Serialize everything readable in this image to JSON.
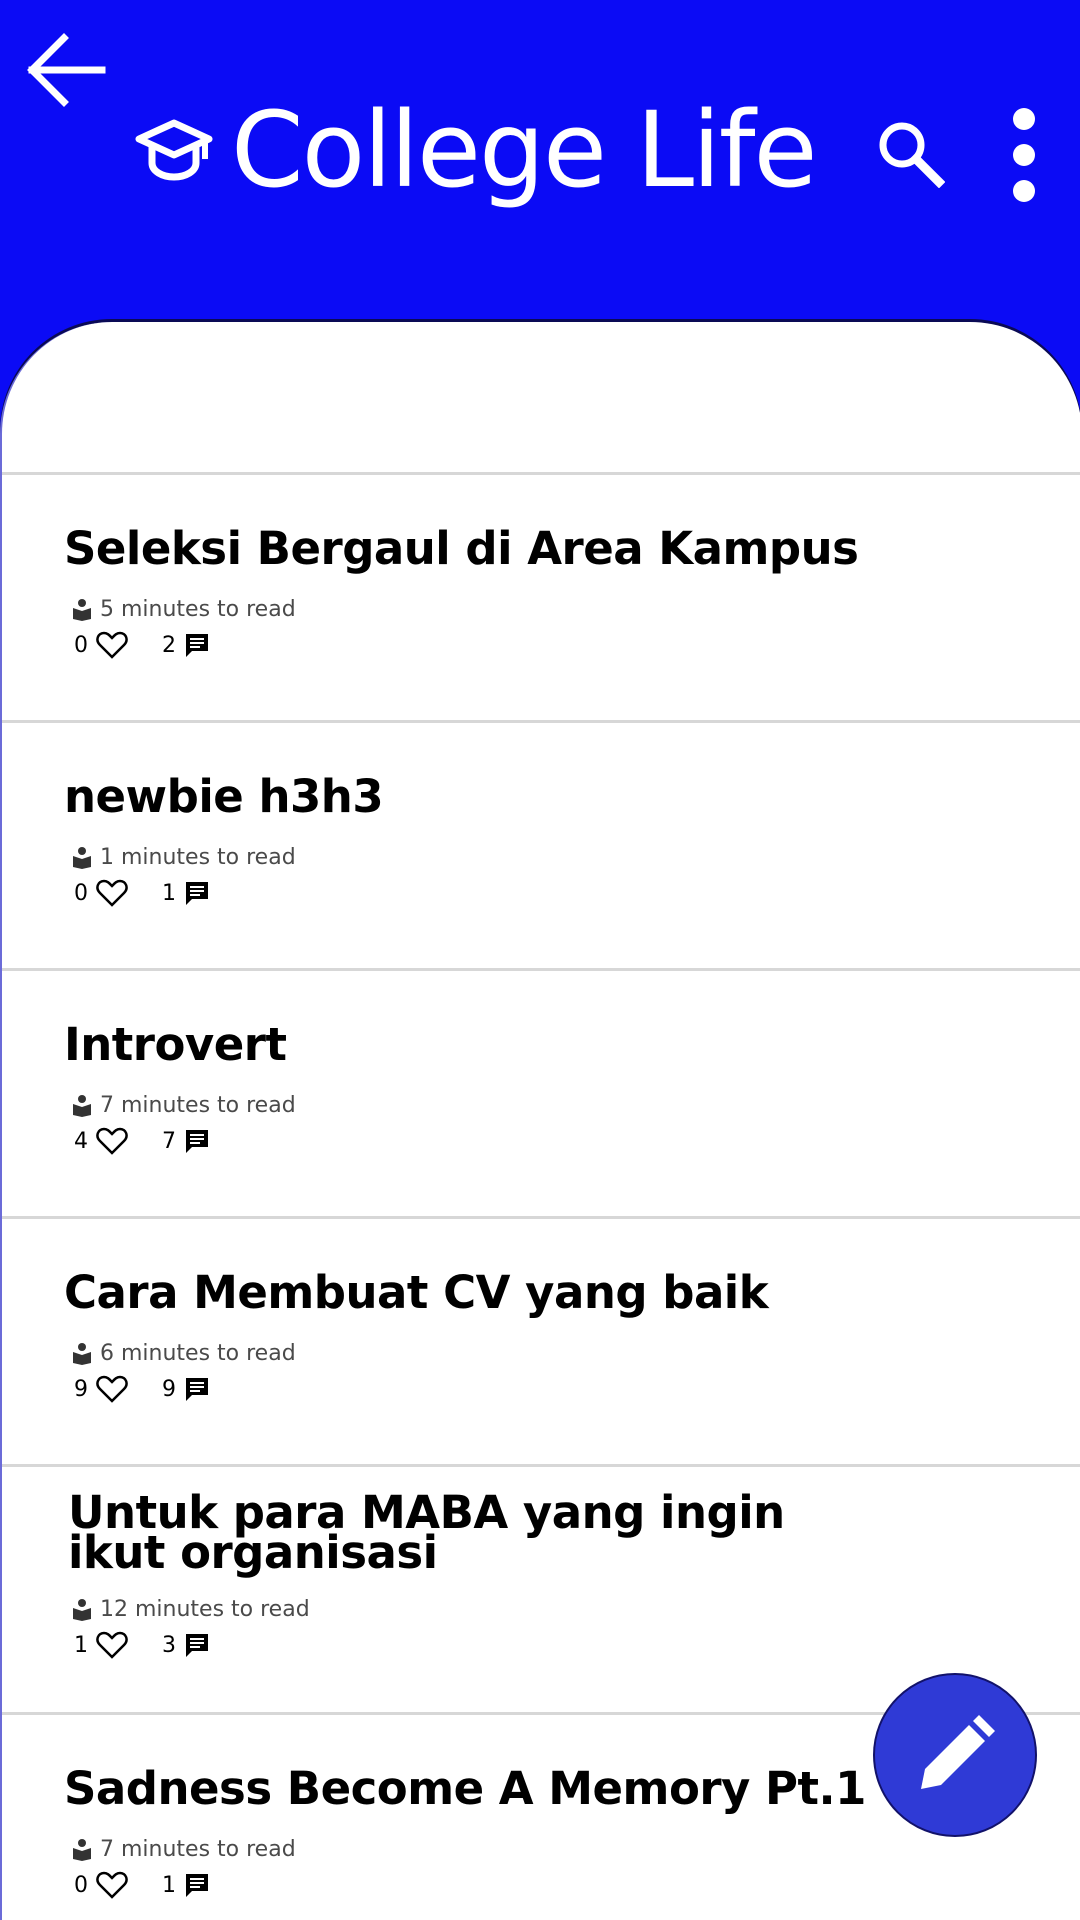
{
  "header": {
    "title": "College Life",
    "back_icon": "arrow-left-icon",
    "title_icon": "graduation-cap-icon",
    "search_icon": "search-icon",
    "menu_icon": "more-vertical-icon",
    "background_color": "#0b0bf5"
  },
  "posts": [
    {
      "title": "Seleksi Bergaul di Area Kampus",
      "read_time": "5 minutes to read",
      "likes": "0",
      "comments": "2"
    },
    {
      "title": "newbie h3h3",
      "read_time": "1 minutes to read",
      "likes": "0",
      "comments": "1"
    },
    {
      "title": "Introvert",
      "read_time": "7 minutes to read",
      "likes": "4",
      "comments": "7"
    },
    {
      "title": "Cara Membuat CV yang baik",
      "read_time": "6 minutes to read",
      "likes": "9",
      "comments": "9"
    },
    {
      "title": "Untuk para MABA yang ingin ikut organisasi",
      "read_time": "12 minutes to read",
      "likes": "1",
      "comments": "3"
    },
    {
      "title": "Sadness Become A Memory Pt.1",
      "read_time": "7 minutes to read",
      "likes": "0",
      "comments": "1"
    }
  ],
  "icons": {
    "read": "book-reader-icon",
    "like": "heart-outline-icon",
    "comment": "comment-icon"
  },
  "fab": {
    "icon": "pencil-icon",
    "color": "#2f3ad6"
  }
}
